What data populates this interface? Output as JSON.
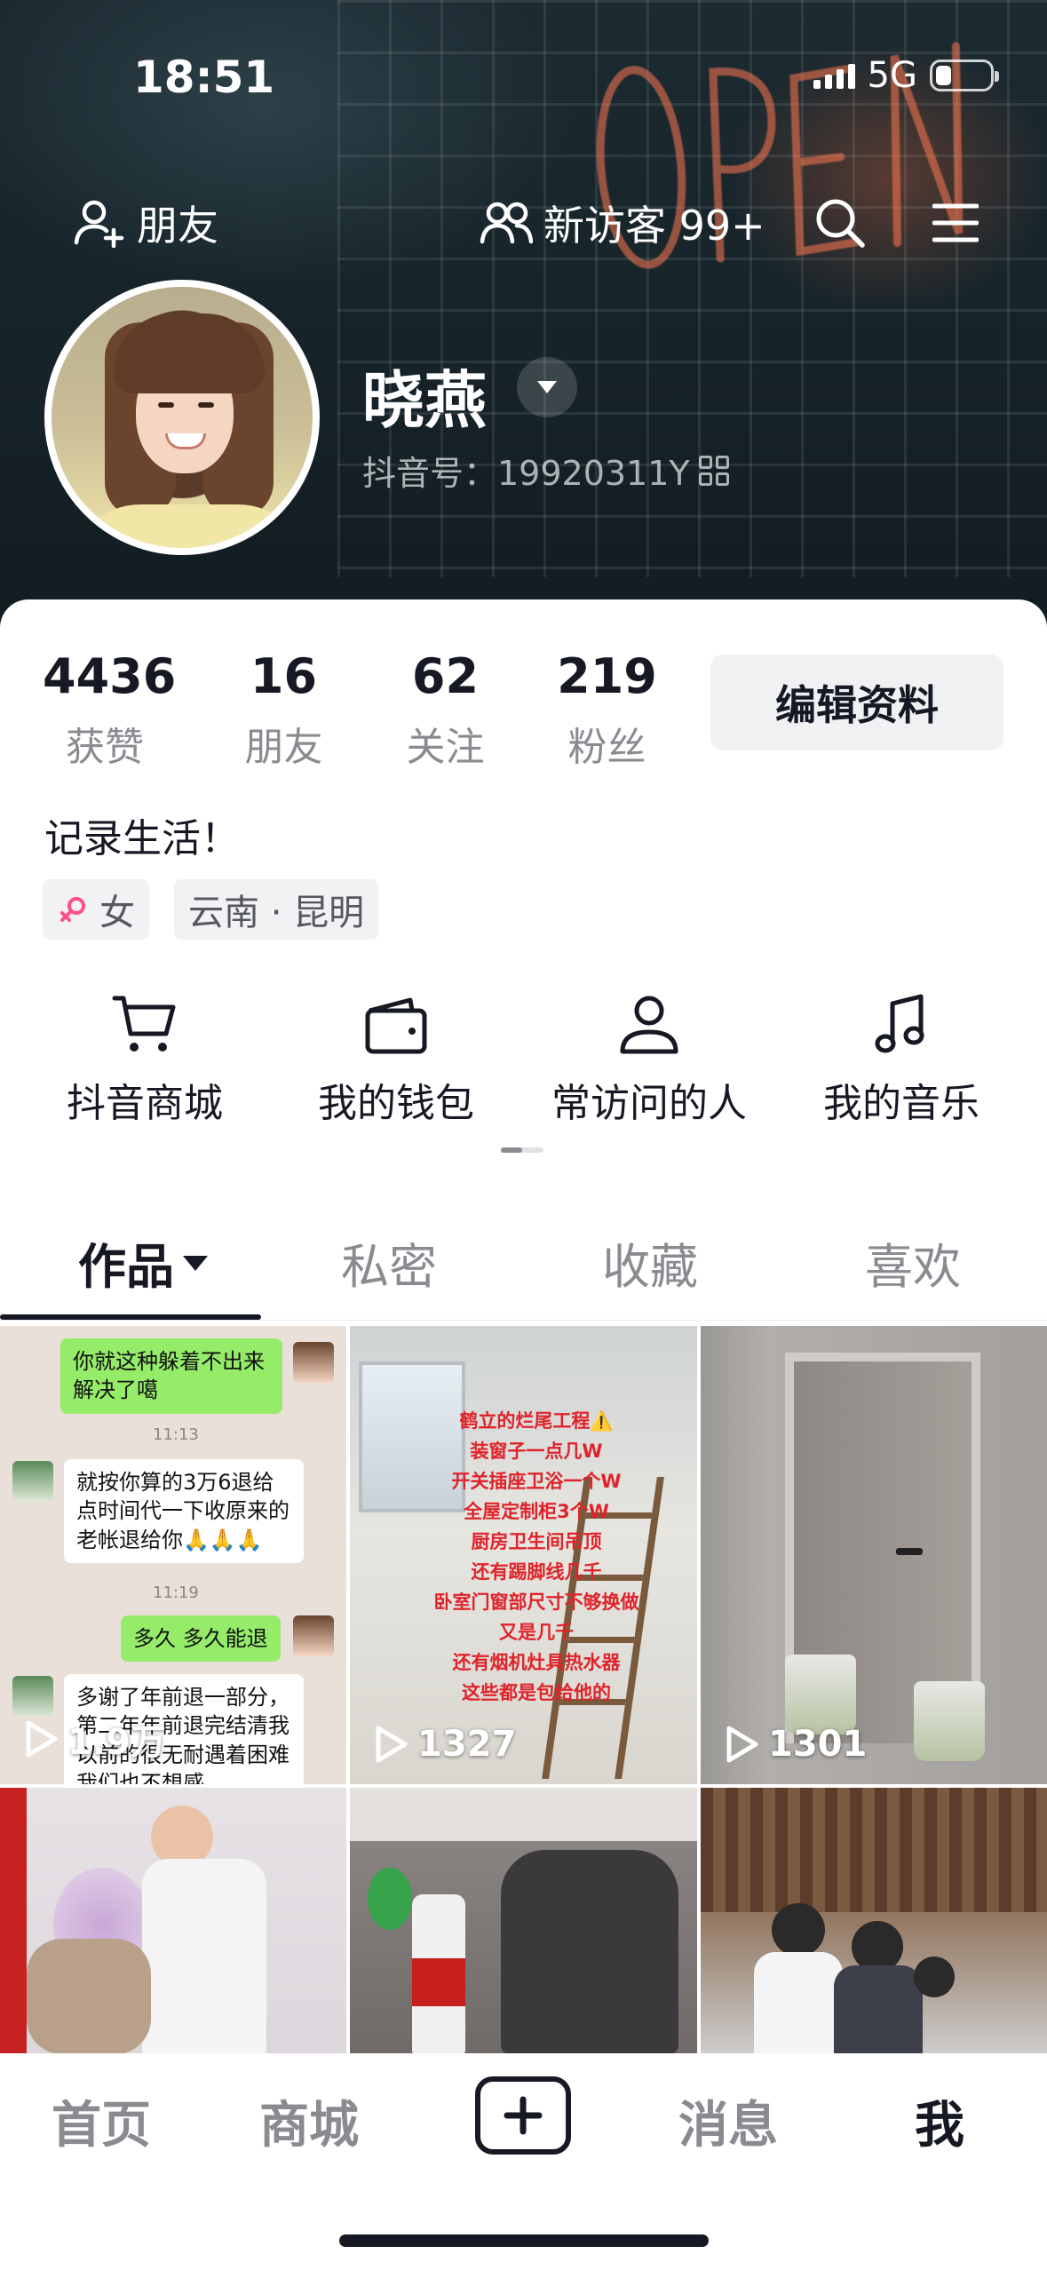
{
  "status_bar": {
    "time": "18:51",
    "network": "5G",
    "battery_level": 0.3
  },
  "top_nav": {
    "friends_label": "朋友",
    "visitors_label": "新访客 99+"
  },
  "profile": {
    "nickname": "晓燕",
    "douyin_id": "抖音号：19920311Y"
  },
  "stats": [
    {
      "value": "4436",
      "label": "获赞"
    },
    {
      "value": "16",
      "label": "朋友"
    },
    {
      "value": "62",
      "label": "关注"
    },
    {
      "value": "219",
      "label": "粉丝"
    }
  ],
  "edit_profile_label": "编辑资料",
  "bio": "记录生活！",
  "tags": {
    "gender": "女",
    "location": "云南 · 昆明"
  },
  "quick_actions": [
    {
      "label": "抖音商城",
      "icon": "cart-icon"
    },
    {
      "label": "我的钱包",
      "icon": "wallet-icon"
    },
    {
      "label": "常访问的人",
      "icon": "person-icon"
    },
    {
      "label": "我的音乐",
      "icon": "music-note-icon"
    }
  ],
  "tabs": [
    {
      "label": "作品",
      "active": true
    },
    {
      "label": "私密",
      "active": false
    },
    {
      "label": "收藏",
      "active": false
    },
    {
      "label": "喜欢",
      "active": false
    }
  ],
  "videos": [
    {
      "plays": "1.9万",
      "chat": {
        "msg1": "你就这种躲着不出来解决了噶",
        "time1": "11:13",
        "msg2": "就按你算的3万6退给点时间代一下收原来的老帐退给你🙏🙏🙏",
        "time2": "11:19",
        "msg3": "多久 多久能退",
        "msg4": "多谢了年前退一部分，第二年年前退完结清我以前的很无耐遇着困难我们也不想感"
      }
    },
    {
      "plays": "1327",
      "overlay_lines": [
        "鹤立的烂尾工程⚠️",
        "装窗子一点几W",
        "开关插座卫浴一个W",
        "全屋定制柜3个W",
        "厨房卫生间吊顶",
        "还有踢脚线几千",
        "卧室门窗部尺寸不够换做",
        "又是几千",
        "还有烟机灶具热水器",
        "这些都是包给他的"
      ]
    },
    {
      "plays": "1301"
    },
    {},
    {},
    {}
  ],
  "bottom_nav": [
    {
      "label": "首页",
      "active": false
    },
    {
      "label": "商城",
      "active": false
    },
    {
      "label": "消息",
      "active": false
    },
    {
      "label": "我",
      "active": true
    }
  ],
  "colors": {
    "text_primary": "#161823",
    "text_secondary": "#8a8b91",
    "button_bg": "#f0f1f3",
    "wechat_green": "#95ec69",
    "overlay_red": "#e0232a"
  }
}
